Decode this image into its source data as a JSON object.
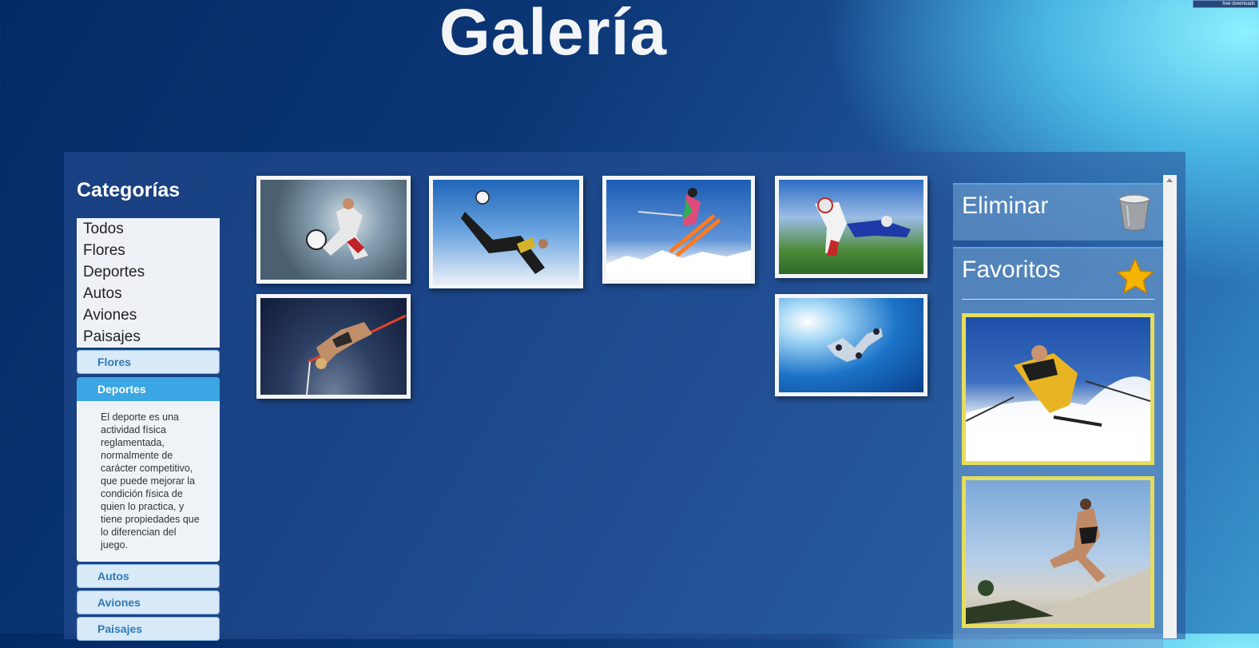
{
  "header": {
    "title": "Galería"
  },
  "badge": {
    "text": "free downloads"
  },
  "categories": {
    "heading": "Categorías",
    "items": [
      {
        "label": "Todos"
      },
      {
        "label": "Flores"
      },
      {
        "label": "Deportes"
      },
      {
        "label": "Autos"
      },
      {
        "label": "Aviones"
      },
      {
        "label": "Paisajes"
      }
    ]
  },
  "accordion": {
    "items": [
      {
        "label": "Flores",
        "active": false
      },
      {
        "label": "Deportes",
        "active": true
      },
      {
        "label": "Autos",
        "active": false
      },
      {
        "label": "Aviones",
        "active": false
      },
      {
        "label": "Paisajes",
        "active": false
      }
    ],
    "active_text": "El deporte es una actividad física reglamentada, normalmente de carácter competitivo, que puede mejorar la condición física de quien lo practica, y tiene propiedades que lo diferencian del juego."
  },
  "gallery": {
    "photos": [
      {
        "subject": "soccer-player-kick"
      },
      {
        "subject": "soccer-bicycle-kick"
      },
      {
        "subject": "freestyle-ski-jump"
      },
      {
        "subject": "american-football-tackle"
      },
      {
        "subject": "high-jump"
      },
      {
        "subject": "skydiving-formation"
      }
    ]
  },
  "sidebar": {
    "delete_box": {
      "title": "Eliminar",
      "icon": "trash-bin-icon"
    },
    "favorites_box": {
      "title": "Favoritos",
      "icon": "star-icon",
      "items": [
        {
          "subject": "downhill-skier"
        },
        {
          "subject": "runner"
        }
      ]
    }
  },
  "colors": {
    "accent": "#3aa6e3",
    "favorite_frame": "#e6dd5d",
    "star": "#f5b400"
  }
}
